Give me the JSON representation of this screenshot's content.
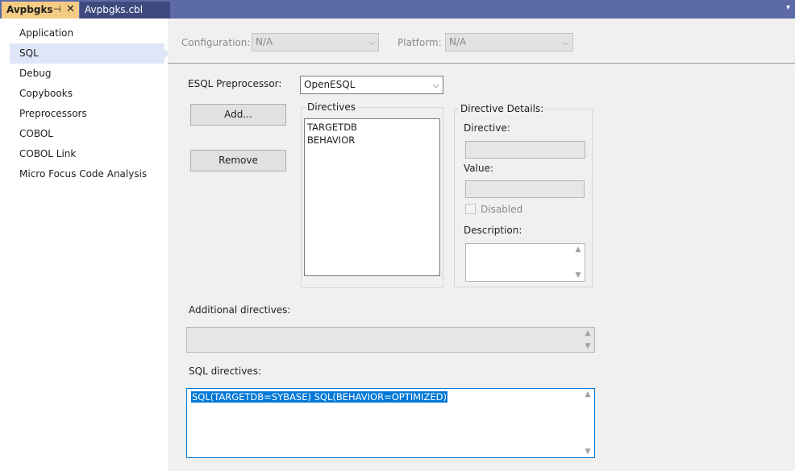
{
  "tabs": [
    {
      "label": "Avpbgks",
      "active": true,
      "pin_glyph": "⊣",
      "close_glyph": "✕"
    },
    {
      "label": "Avpbgks.cbl",
      "active": false
    }
  ],
  "tab_menu_glyph": "▾",
  "sidebar": {
    "items": [
      {
        "label": "Application"
      },
      {
        "label": "SQL"
      },
      {
        "label": "Debug"
      },
      {
        "label": "Copybooks"
      },
      {
        "label": "Preprocessors"
      },
      {
        "label": "COBOL"
      },
      {
        "label": "COBOL Link"
      },
      {
        "label": "Micro Focus Code Analysis"
      }
    ]
  },
  "config": {
    "configuration_label": "Configuration:",
    "configuration_value": "N/A",
    "platform_label": "Platform:",
    "platform_value": "N/A"
  },
  "esql": {
    "label": "ESQL Preprocessor:",
    "value": "OpenESQL"
  },
  "buttons": {
    "add": "Add...",
    "remove": "Remove"
  },
  "directives": {
    "title": "Directives",
    "items": [
      "TARGETDB",
      "BEHAVIOR"
    ]
  },
  "details": {
    "title": "Directive Details:",
    "directive_label": "Directive:",
    "value_label": "Value:",
    "disabled_label": "Disabled",
    "description_label": "Description:"
  },
  "additional": {
    "label": "Additional directives:"
  },
  "sql_directives": {
    "label": "SQL directives:",
    "value": "SQL(TARGETDB=SYBASE) SQL(BEHAVIOR=OPTIMIZED)"
  },
  "icons": {
    "dropdown": "⌵",
    "scroll_up": "▲",
    "scroll_down": "▼"
  },
  "colors": {
    "tabbar": "#5c6aa6",
    "active_tab": "#f5cc84",
    "selection": "#0078d7",
    "nav_selected": "#dfe6f7"
  }
}
